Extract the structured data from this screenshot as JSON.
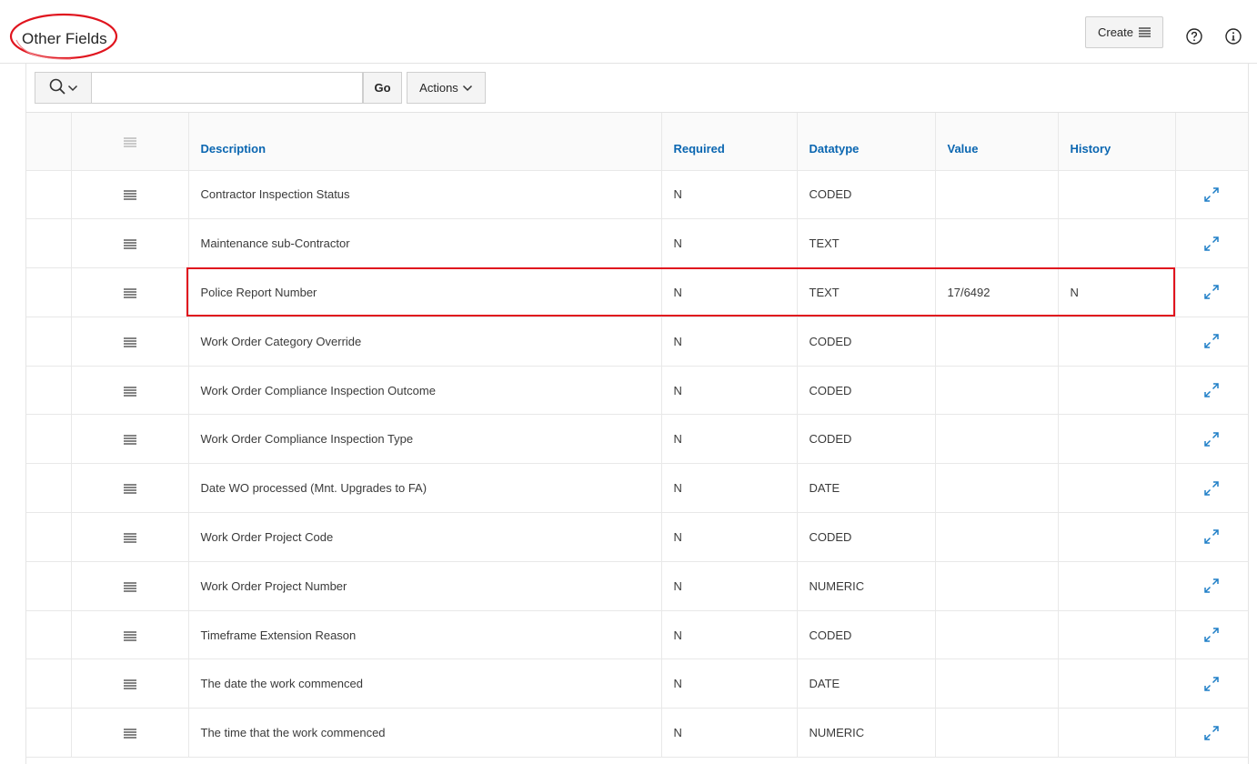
{
  "region": {
    "title": "Other Fields",
    "create_label": "Create"
  },
  "toolbar": {
    "search_placeholder": "",
    "go_label": "Go",
    "actions_label": "Actions"
  },
  "columns": {
    "description": "Description",
    "required": "Required",
    "datatype": "Datatype",
    "value": "Value",
    "history": "History"
  },
  "rows": [
    {
      "description": "Contractor Inspection Status",
      "required": "N",
      "datatype": "CODED",
      "value": "",
      "history": ""
    },
    {
      "description": "Maintenance sub-Contractor",
      "required": "N",
      "datatype": "TEXT",
      "value": "",
      "history": ""
    },
    {
      "description": "Police Report Number",
      "required": "N",
      "datatype": "TEXT",
      "value": "17/6492",
      "history": "N"
    },
    {
      "description": "Work Order Category Override",
      "required": "N",
      "datatype": "CODED",
      "value": "",
      "history": ""
    },
    {
      "description": "Work Order Compliance Inspection Outcome",
      "required": "N",
      "datatype": "CODED",
      "value": "",
      "history": ""
    },
    {
      "description": "Work Order Compliance Inspection Type",
      "required": "N",
      "datatype": "CODED",
      "value": "",
      "history": ""
    },
    {
      "description": "Date WO processed (Mnt. Upgrades to FA)",
      "required": "N",
      "datatype": "DATE",
      "value": "",
      "history": ""
    },
    {
      "description": "Work Order Project Code",
      "required": "N",
      "datatype": "CODED",
      "value": "",
      "history": ""
    },
    {
      "description": "Work Order Project Number",
      "required": "N",
      "datatype": "NUMERIC",
      "value": "",
      "history": ""
    },
    {
      "description": "Timeframe Extension Reason",
      "required": "N",
      "datatype": "CODED",
      "value": "",
      "history": ""
    },
    {
      "description": "The date the work commenced",
      "required": "N",
      "datatype": "DATE",
      "value": "",
      "history": ""
    },
    {
      "description": "The time that the work commenced",
      "required": "N",
      "datatype": "NUMERIC",
      "value": "",
      "history": ""
    }
  ],
  "colors": {
    "accent": "#0a66b1",
    "highlight": "#e0141e",
    "expand_icon": "#1e7fc7"
  },
  "icons": {
    "search": "search-icon",
    "chevron": "chevron-down-icon",
    "menu": "hamburger-menu-icon",
    "help": "help-icon",
    "info": "info-icon",
    "expand": "expand-icon"
  }
}
